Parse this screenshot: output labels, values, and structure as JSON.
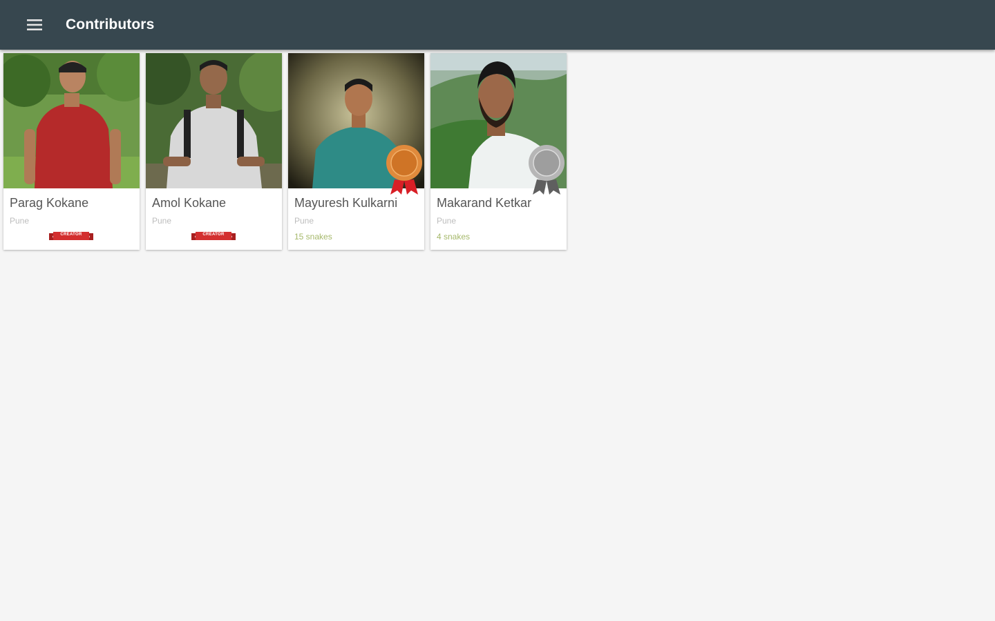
{
  "appbar": {
    "title": "Contributors",
    "menu_icon": "menu-icon",
    "background": "#37474f"
  },
  "contributors": [
    {
      "name": "Parag Kokane",
      "city": "Pune",
      "count": "",
      "badge": "ribbon",
      "badge_text": "CREATOR"
    },
    {
      "name": "Amol Kokane",
      "city": "Pune",
      "count": "",
      "badge": "ribbon",
      "badge_text": "CREATOR"
    },
    {
      "name": "Mayuresh Kulkarni",
      "city": "Pune",
      "count": "15 snakes",
      "badge": "bronze-medal",
      "badge_text": ""
    },
    {
      "name": "Makarand Ketkar",
      "city": "Pune",
      "count": "4 snakes",
      "badge": "silver-medal",
      "badge_text": ""
    }
  ],
  "colors": {
    "count_text": "#a5b86a",
    "ribbon": "#d32f2f",
    "bronze": "#e08a3c",
    "silver": "#9e9e9e"
  }
}
